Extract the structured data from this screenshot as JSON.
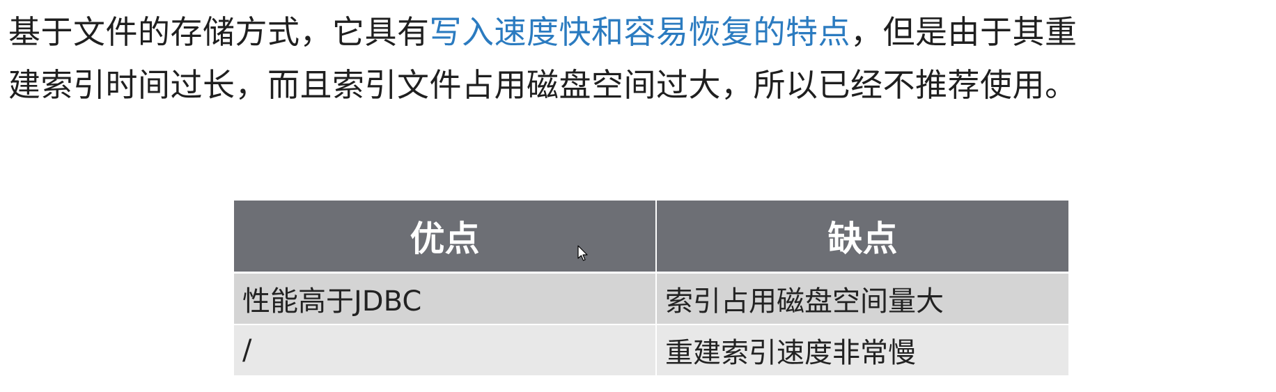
{
  "paragraph": {
    "line1_before": "基于文件的存储方式，它具有",
    "line1_highlight": "写入速度快和容易恢复的特点",
    "line1_after": "，但是由于其重",
    "line2": "建索引时间过长，而且索引文件占用磁盘空间过大，所以已经不推荐使用。"
  },
  "colors": {
    "highlight": "#2b7bc0",
    "header_bg": "#6d6f75",
    "row_odd_bg": "#d4d4d4",
    "row_even_bg": "#e8e8e8"
  },
  "table": {
    "headers": [
      "优点",
      "缺点"
    ],
    "rows": [
      [
        "性能高于JDBC",
        "索引占用磁盘空间量大"
      ],
      [
        "/",
        "重建索引速度非常慢"
      ]
    ]
  },
  "cursor": {
    "icon": "mouse-pointer-icon"
  }
}
